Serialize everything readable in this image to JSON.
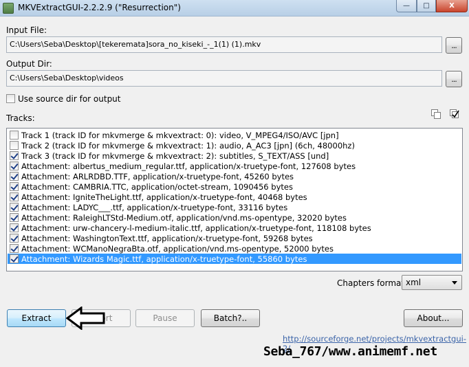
{
  "window": {
    "title": "MKVExtractGUI-2.2.2.9 (\"Resurrection\")",
    "min_label": "—",
    "max_label": "□",
    "close_label": "X"
  },
  "input": {
    "label": "Input File:",
    "value": "C:\\Users\\Seba\\Desktop\\[tekeremata]sora_no_kiseki_-_1(1) (1).mkv",
    "browse_label": "..."
  },
  "output": {
    "label": "Output Dir:",
    "value": "C:\\Users\\Seba\\Desktop\\videos",
    "browse_label": "..."
  },
  "use_source_dir": {
    "label": "Use source dir for output",
    "checked": false
  },
  "tracks": {
    "label": "Tracks:",
    "icons": [
      "copy-icon",
      "check-all-icon"
    ],
    "items": [
      {
        "label": "Track 1 (track ID for mkvmerge & mkvextract: 0): video, V_MPEG4/ISO/AVC [jpn]",
        "checked": false
      },
      {
        "label": "Track 2 (track ID for mkvmerge & mkvextract: 1): audio, A_AC3 [jpn]  (6ch, 48000hz)",
        "checked": false
      },
      {
        "label": "Track 3 (track ID for mkvmerge & mkvextract: 2): subtitles, S_TEXT/ASS [und]",
        "checked": true
      },
      {
        "label": "Attachment: albertus_medium_regular.ttf, application/x-truetype-font, 127608 bytes",
        "checked": true
      },
      {
        "label": "Attachment: ARLRDBD.TTF, application/x-truetype-font, 45260 bytes",
        "checked": true
      },
      {
        "label": "Attachment: CAMBRIA.TTC, application/octet-stream, 1090456 bytes",
        "checked": true
      },
      {
        "label": "Attachment: IgniteTheLight.ttf, application/x-truetype-font, 40468 bytes",
        "checked": true
      },
      {
        "label": "Attachment: LADYC___.ttf, application/x-truetype-font, 33116 bytes",
        "checked": true
      },
      {
        "label": "Attachment: RaleighLTStd-Medium.otf, application/vnd.ms-opentype, 32020 bytes",
        "checked": true
      },
      {
        "label": "Attachment: urw-chancery-l-medium-italic.ttf, application/x-truetype-font, 118108 bytes",
        "checked": true
      },
      {
        "label": "Attachment: WashingtonText.ttf, application/x-truetype-font, 59268 bytes",
        "checked": true
      },
      {
        "label": "Attachment: WCManoNegraBta.otf, application/vnd.ms-opentype, 52000 bytes",
        "checked": true
      },
      {
        "label": "Attachment: Wizards Magic.ttf, application/x-truetype-font, 55860 bytes",
        "checked": true,
        "selected": true
      }
    ]
  },
  "chapters": {
    "label": "Chapters format:",
    "value": "xml"
  },
  "buttons": {
    "extract": "Extract",
    "abort": "Abort",
    "pause": "Pause",
    "batch": "Batch?..",
    "about": "About..."
  },
  "footer": {
    "link": "http://sourceforge.net/projects/mkvextractgui-2/",
    "watermark": "Seba_767/www.animemf.net"
  },
  "colors": {
    "selection": "#3399ff",
    "link": "#3a63a8",
    "focus_border": "#3c7fb1"
  }
}
